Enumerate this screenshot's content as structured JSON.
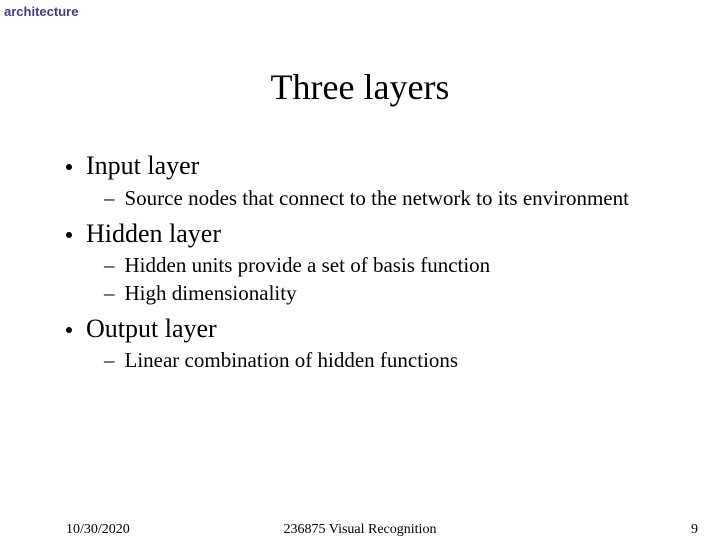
{
  "header": {
    "label": "architecture"
  },
  "title": "Three layers",
  "bullets": [
    {
      "text": "Input layer",
      "subs": [
        "Source nodes that connect to the network to its environment"
      ]
    },
    {
      "text": "Hidden layer",
      "subs": [
        "Hidden units provide a set of basis function",
        "High dimensionality"
      ]
    },
    {
      "text": "Output layer",
      "subs": [
        "Linear combination of hidden functions"
      ]
    }
  ],
  "footer": {
    "date": "10/30/2020",
    "course": "236875 Visual Recognition",
    "page": "9"
  }
}
